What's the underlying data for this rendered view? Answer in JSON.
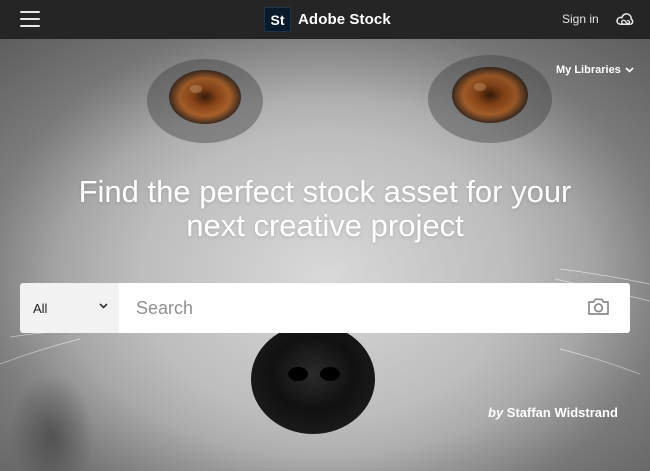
{
  "header": {
    "brand_logo_text": "St",
    "brand_name": "Adobe Stock",
    "signin_label": "Sign in",
    "menu_icon": "hamburger-menu-icon",
    "cc_icon": "creative-cloud-icon"
  },
  "hero": {
    "my_libraries_label": "My Libraries",
    "headline_line1": "Find the perfect stock asset for your",
    "headline_line2": "next creative project",
    "photo_credit_prefix": "by",
    "photo_credit_name": "Staffan Widstrand"
  },
  "search": {
    "filter_value": "All",
    "placeholder": "Search",
    "value": "",
    "camera_icon": "camera-icon"
  },
  "colors": {
    "topbar": "#252525",
    "brand_logo_bg": "#0a1a2b",
    "text_white": "#ffffff",
    "filter_bg": "#f2f2f2"
  }
}
